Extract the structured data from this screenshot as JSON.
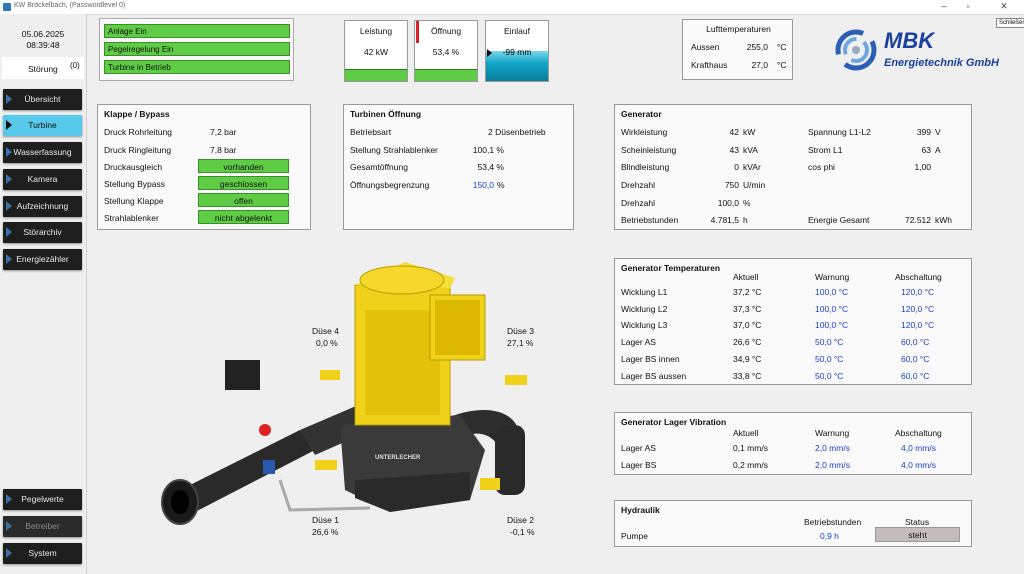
{
  "window": {
    "title": "KW Bröckelbach, (Passwordlevel 0)",
    "tooltip": "Schließen"
  },
  "header": {
    "date": "05.06.2025",
    "time": "08:39:48",
    "stoerung_label": "Störung",
    "stoerung_count": "(0)"
  },
  "nav": {
    "items": [
      "Übersicht",
      "Turbine",
      "Wasserfassung",
      "Kamera",
      "Aufzeichnung",
      "Störarchiv",
      "Energiezähler"
    ],
    "bottom": [
      "Pegelwerte",
      "Betreiber",
      "System"
    ]
  },
  "status": [
    "Anlage Ein",
    "Pegelregelung Ein",
    "Turbine in Betrieb"
  ],
  "gauges": {
    "leistung": {
      "label": "Leistung",
      "value": "42  kW",
      "level": 0.18
    },
    "oeffnung": {
      "label": "Öffnung",
      "value": "53,4 %",
      "level": 0.18
    },
    "einlauf": {
      "label": "Einlauf",
      "value": "-99  mm",
      "level": 0.5
    }
  },
  "luft": {
    "title": "Lufttemperaturen",
    "rows": [
      [
        "Aussen",
        "255,0",
        "°C"
      ],
      [
        "Krafthaus",
        "27,0",
        "°C"
      ]
    ]
  },
  "logo": {
    "name": "MBK",
    "sub": "Energietechnik GmbH"
  },
  "klappe": {
    "title": "Klappe / Bypass",
    "rows": [
      [
        "Druck Rohrleitung",
        "7,2 bar"
      ],
      [
        "Druck Ringleitung",
        "7,8 bar"
      ]
    ],
    "states": [
      [
        "Druckausgleich",
        "vorhanden"
      ],
      [
        "Stellung Bypass",
        "geschlossen"
      ],
      [
        "Stellung Klappe",
        "offen"
      ],
      [
        "Strahlablenker",
        "nicht abgelenkt"
      ]
    ]
  },
  "turbine": {
    "title": "Turbinen Öffnung",
    "rows": [
      [
        "Betriebsart",
        "2  Düsenbetrieb"
      ],
      [
        "Stellung Strahlablenker",
        "100,1 %"
      ],
      [
        "Gesamtöffnung",
        "53,4 %"
      ],
      [
        "Öffnungsbegrenzung",
        "150,0"
      ]
    ],
    "unit": "%"
  },
  "generator": {
    "title": "Generator",
    "left": [
      [
        "Wirkleistung",
        "42",
        "kW"
      ],
      [
        "Scheinleistung",
        "43",
        "kVA"
      ],
      [
        "Blindleistung",
        "0",
        "kVAr"
      ],
      [
        "Drehzahl",
        "750",
        "U/min"
      ],
      [
        "Drehzahl",
        "100,0",
        "%"
      ],
      [
        "Betriebstunden",
        "4.781,5",
        "h"
      ]
    ],
    "right": [
      [
        "Spannung L1-L2",
        "399",
        "V"
      ],
      [
        "Strom L1",
        "63",
        "A"
      ],
      [
        "cos phi",
        "1,00",
        ""
      ],
      [
        "Energie Gesamt",
        "72.512",
        "kWh"
      ]
    ]
  },
  "gentemp": {
    "title": "Generator Temperaturen",
    "cols": [
      "Aktuell",
      "Warnung",
      "Abschaltung"
    ],
    "rows": [
      [
        "Wicklung L1",
        "37,2 °C",
        "100,0 °C",
        "120,0 °C"
      ],
      [
        "Wicklung L2",
        "37,3 °C",
        "100,0 °C",
        "120,0 °C"
      ],
      [
        "Wicklung L3",
        "37,0 °C",
        "100,0 °C",
        "120,0 °C"
      ],
      [
        "Lager AS",
        "26,6 °C",
        "50,0 °C",
        "60,0 °C"
      ],
      [
        "Lager BS innen",
        "34,9 °C",
        "50,0 °C",
        "60,0 °C"
      ],
      [
        "Lager BS aussen",
        "33,8 °C",
        "50,0 °C",
        "60,0 °C"
      ]
    ]
  },
  "vib": {
    "title": "Generator Lager Vibration",
    "cols": [
      "Aktuell",
      "Warnung",
      "Abschaltung"
    ],
    "rows": [
      [
        "Lager AS",
        "0,1 mm/s",
        "2,0 mm/s",
        "4,0 mm/s"
      ],
      [
        "Lager BS",
        "0,2 mm/s",
        "2,0 mm/s",
        "4,0 mm/s"
      ]
    ]
  },
  "hydraulik": {
    "title": "Hydraulik",
    "cols": [
      "Betriebstunden",
      "Status"
    ],
    "row": [
      "Pumpe",
      "0,9 h",
      "steht"
    ]
  },
  "duesen": {
    "d4": [
      "Düse 4",
      "0,0  %"
    ],
    "d3": [
      "Düse 3",
      "27,1  %"
    ],
    "d1": [
      "Düse 1",
      "26,6  %"
    ],
    "d2": [
      "Düse 2",
      "-0,1  %"
    ]
  },
  "machine_label": "UNTERLECHER",
  "colors": {
    "accent_green": "#5fcc45",
    "nav_active": "#57c9ea",
    "value_blue": "#1a3fcf",
    "machine_yellow": "#f1d21a"
  }
}
